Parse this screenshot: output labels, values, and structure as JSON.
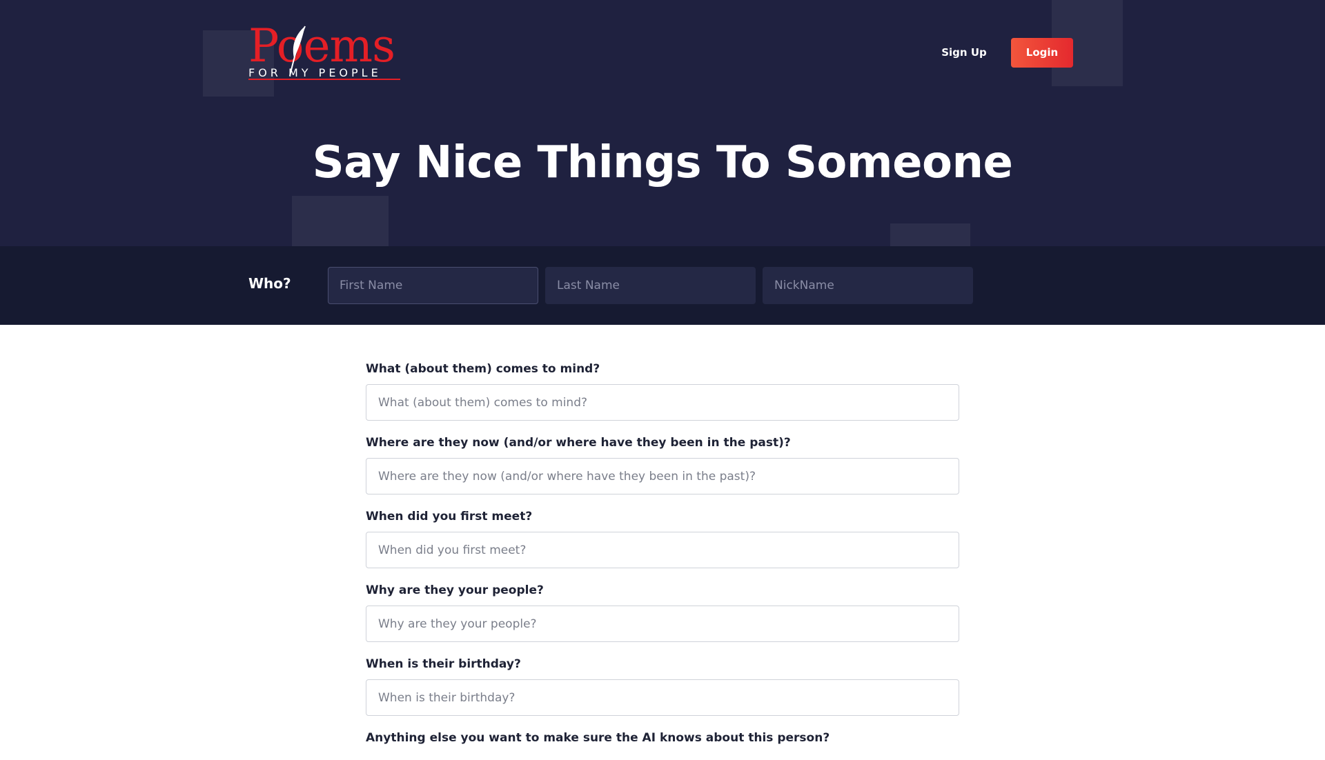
{
  "header": {
    "logo": {
      "main_text": "Poems",
      "sub_text": "FOR MY PEOPLE"
    },
    "nav": {
      "signup_label": "Sign Up",
      "login_label": "Login"
    },
    "title": "Say Nice Things To Someone"
  },
  "who": {
    "label": "Who?",
    "first_name_placeholder": "First Name",
    "last_name_placeholder": "Last Name",
    "nickname_placeholder": "NickName"
  },
  "form": {
    "fields": [
      {
        "label": "What (about them) comes to mind?",
        "placeholder": "What (about them) comes to mind?"
      },
      {
        "label": "Where are they now (and/or where have they been in the past)?",
        "placeholder": "Where are they now (and/or where have they been in the past)?"
      },
      {
        "label": "When did you first meet?",
        "placeholder": "When did you first meet?"
      },
      {
        "label": "Why are they your people?",
        "placeholder": "Why are they your people?"
      },
      {
        "label": "When is their birthday?",
        "placeholder": "When is their birthday?"
      },
      {
        "label": "Anything else you want to make sure the AI knows about this person?",
        "placeholder": ""
      }
    ]
  },
  "colors": {
    "hero_bg": "#1f2140",
    "who_bar_bg": "#161a31",
    "accent": "#e41f26",
    "login_gradient_start": "#f2563c"
  }
}
